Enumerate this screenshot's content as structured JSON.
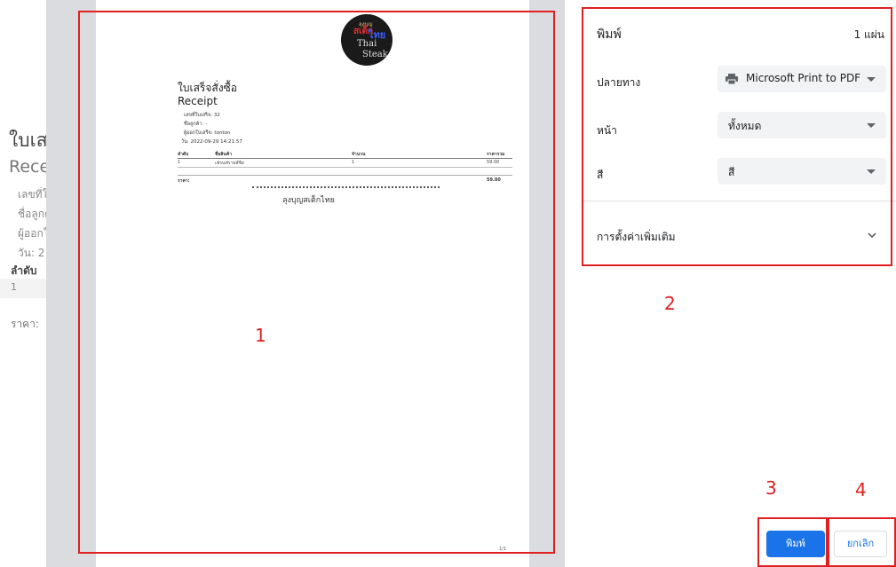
{
  "background_page": {
    "title": "ใบเส",
    "subtitle": "Rece",
    "fields": [
      "เลขที่ใ",
      "ชื่อลูกค",
      "ผู้ออกใ",
      "วัน: 2"
    ],
    "table_header": "ลำดับ",
    "row_1": "1",
    "price": "ราคา:"
  },
  "preview": {
    "logo": {
      "line1": "ลุงบุญ",
      "line2": "สเต็ก",
      "line3": "ไทย",
      "line4": "Thai",
      "line5": "Steak"
    },
    "doc_title": "ใบเสร็จสั่งซื้อ",
    "doc_subtitle": "Receipt",
    "meta": [
      "เลขที่ใบเสร็จ: 32",
      "ชื่อลูกค้า: -",
      "ผู้ออกใบเสร็จ: tonton",
      "วัน: 2022-09-29 14:21:57"
    ],
    "table": {
      "headers": [
        "ลำดับ",
        "ชื่อสินค้า",
        "จำนวน",
        "ราคารวม"
      ],
      "rows": [
        [
          "1",
          "เฟรนฟรายส์ชีส",
          "1",
          "59.00"
        ]
      ],
      "total_label": "ราคา:",
      "total_value": "59.00"
    },
    "shop_name": "ลุงบุญสเต็กไทย",
    "page_number": "1/1"
  },
  "settings": {
    "title": "พิมพ์",
    "sheet_count": "1 แผ่น",
    "destination_label": "ปลายทาง",
    "destination_value": "Microsoft Print to PDF",
    "pages_label": "หน้า",
    "pages_value": "ทั้งหมด",
    "color_label": "สี",
    "color_value": "สี",
    "more_settings": "การตั้งค่าเพิ่มเติม",
    "print_button": "พิมพ์",
    "cancel_button": "ยกเลิก"
  },
  "annotations": [
    "1",
    "2",
    "3",
    "4"
  ],
  "colors": {
    "annotation": "#e02020",
    "primary": "#1a73e8",
    "preview_bg": "#dadce0"
  }
}
